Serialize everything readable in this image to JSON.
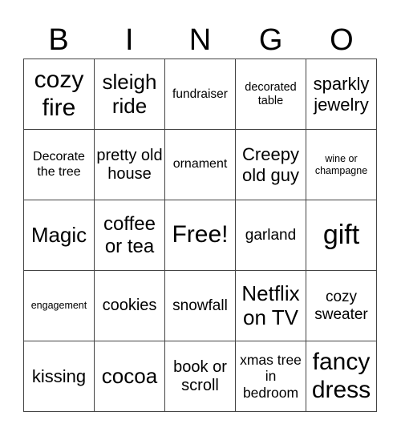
{
  "header": {
    "letters": [
      "B",
      "I",
      "N",
      "G",
      "O"
    ]
  },
  "grid": {
    "rows": [
      [
        "cozy fire",
        "sleigh ride",
        "fundraiser",
        "decorated table",
        "sparkly jewelry"
      ],
      [
        "Decorate the tree",
        "pretty old house",
        "ornament",
        "Creepy old guy",
        "wine or champagne"
      ],
      [
        "Magic",
        "coffee or tea",
        "Free!",
        "garland",
        "gift"
      ],
      [
        "engagement",
        "cookies",
        "snowfall",
        "Netflix on TV",
        "cozy sweater"
      ],
      [
        "kissing",
        "cocoa",
        "book or scroll",
        "xmas tree in bedroom",
        "fancy dress"
      ]
    ],
    "free_space": "Free!"
  },
  "colors": {
    "border": "#444444",
    "background": "#ffffff",
    "text": "#000000"
  }
}
